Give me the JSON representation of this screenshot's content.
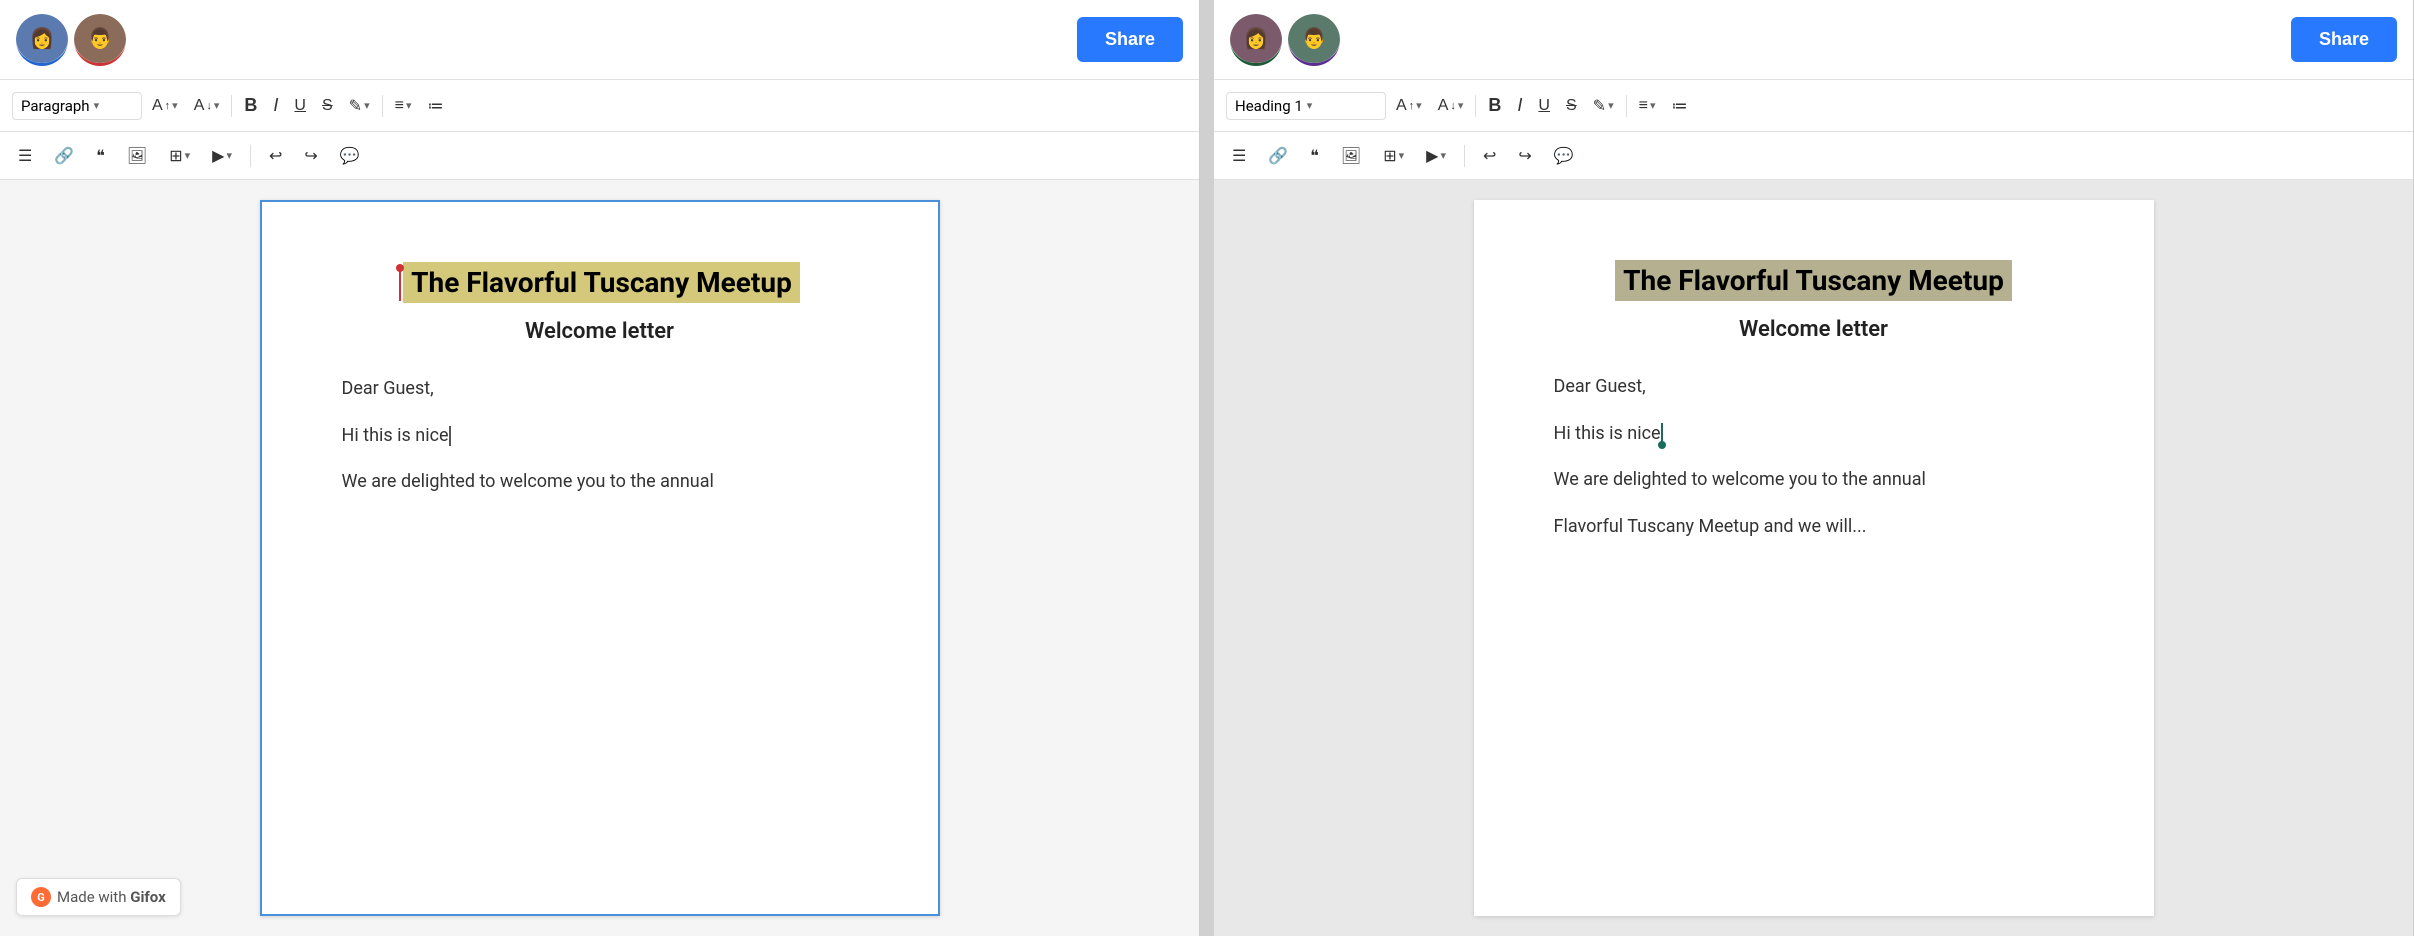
{
  "leftPanel": {
    "share_label": "Share",
    "style_select": "Paragraph",
    "toolbar": {
      "font_size_up": "A↑",
      "font_size_down": "A↓",
      "bold": "B",
      "italic": "I",
      "underline": "U",
      "strikethrough": "S",
      "highlight": "✎",
      "align": "≡",
      "list_ordered": "≔",
      "list_bullet": "☰",
      "link": "🔗",
      "quote": "❝",
      "image": "🖼",
      "table": "⊞",
      "video": "▶",
      "undo": "↩",
      "redo": "↪",
      "comment": "💬"
    },
    "document": {
      "heading": "The Flavorful Tuscany Meetup",
      "subtitle": "Welcome letter",
      "para1": "Dear Guest,",
      "para2": "Hi this is nice",
      "para3": "We are delighted to welcome you to the annual"
    }
  },
  "rightPanel": {
    "share_label": "Share",
    "style_select": "Heading 1",
    "document": {
      "heading": "The Flavorful Tuscany Meetup",
      "subtitle": "Welcome letter",
      "para1": "Dear Guest,",
      "para2": "Hi this is nice",
      "para3": "We are delighted to welcome you to the annual",
      "para4": "Flavorful Tuscany Meetup and we will..."
    }
  },
  "footer": {
    "made_with": "Made with",
    "brand": "Gifox"
  }
}
